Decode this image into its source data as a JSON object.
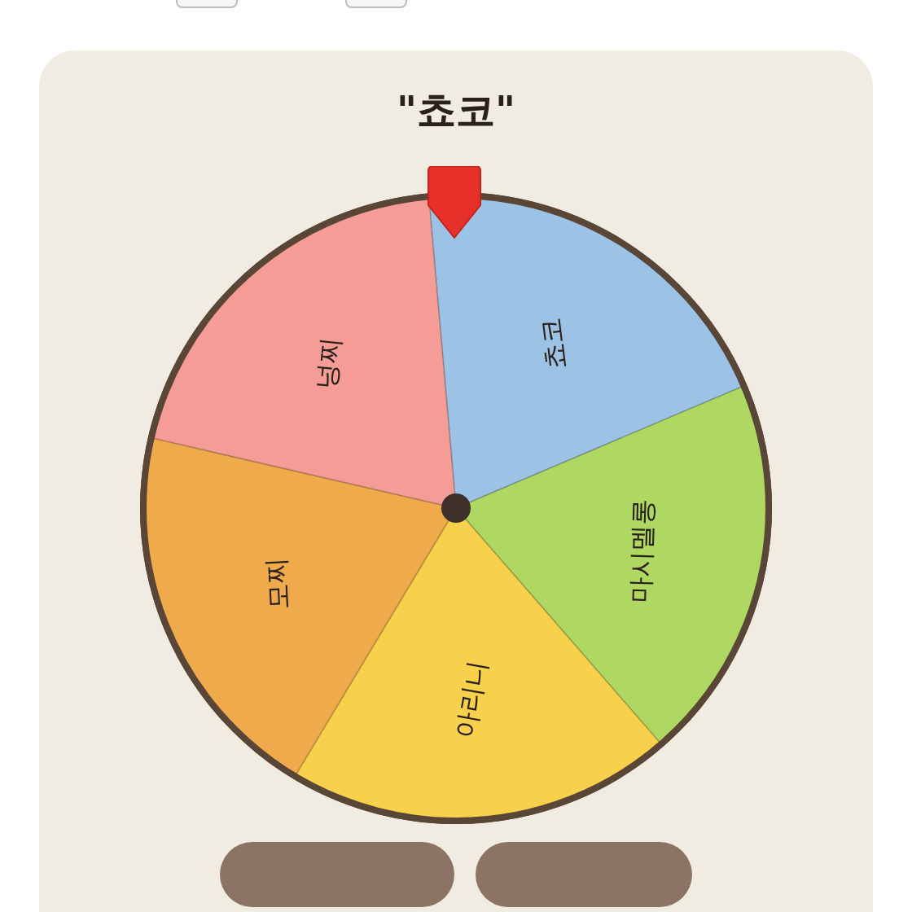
{
  "result": "\"쵸코\"",
  "segments": [
    {
      "label": "쵸코",
      "color": "#9cc3e6"
    },
    {
      "label": "마시멜롱",
      "color": "#afd863"
    },
    {
      "label": "아리니",
      "color": "#f7d04c"
    },
    {
      "label": "모찌",
      "color": "#efaa4c"
    },
    {
      "label": "넝찌",
      "color": "#f59c97"
    }
  ]
}
